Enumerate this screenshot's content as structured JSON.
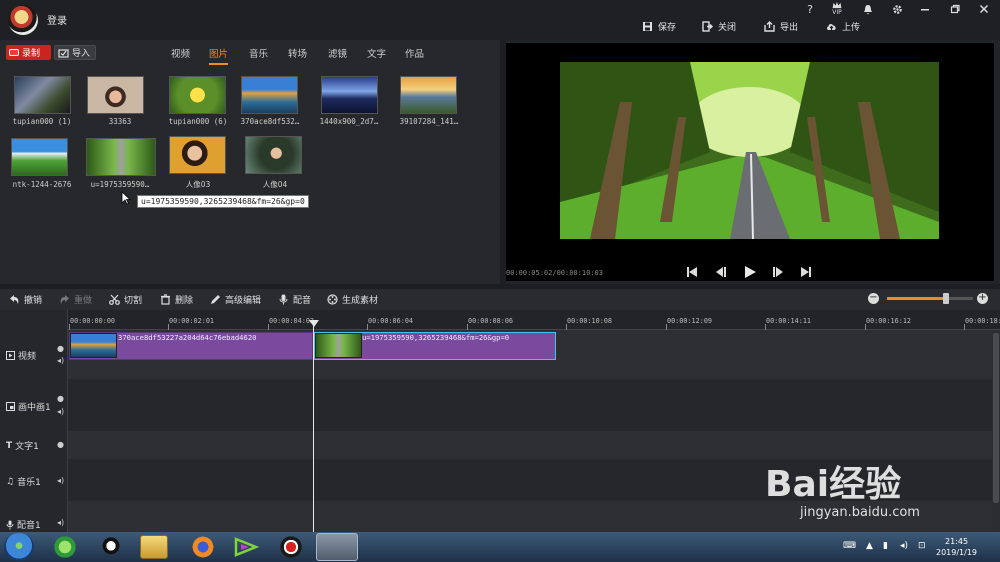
{
  "app": {
    "login_label": "登录"
  },
  "window_actions": [
    {
      "icon": "save-icon",
      "label": "保存"
    },
    {
      "icon": "close-file-icon",
      "label": "关闭"
    },
    {
      "icon": "export-icon",
      "label": "导出"
    },
    {
      "icon": "upload-icon",
      "label": "上传"
    }
  ],
  "window_controls": {
    "help": "?",
    "vip": "VIP"
  },
  "library": {
    "record_label": "录制",
    "import_label": "导入",
    "tabs": [
      "视频",
      "图片",
      "音乐",
      "转场",
      "滤镜",
      "文字",
      "作品"
    ],
    "active_tab": "图片",
    "items": [
      {
        "caption": "tupian000 (1)"
      },
      {
        "caption": "33363"
      },
      {
        "caption": "tupian000 (6)"
      },
      {
        "caption": "370ace8df532…"
      },
      {
        "caption": "1440x900_2d7…"
      },
      {
        "caption": "39107284_141…"
      },
      {
        "caption": "ntk-1244-2676"
      },
      {
        "caption": "u=1975359590…"
      },
      {
        "caption": "人像03"
      },
      {
        "caption": "人像04"
      }
    ],
    "tooltip": "u=1975359590,3265239468&fm=26&gp=0"
  },
  "preview": {
    "time": "00:00:05:02/00:00:10:03"
  },
  "edit_toolbar": {
    "undo": "撤销",
    "redo": "重做",
    "cut": "切割",
    "delete": "删除",
    "advanced": "高级编辑",
    "dub": "配音",
    "generate": "生成素材"
  },
  "zoom": {
    "level": 0.7
  },
  "timeline": {
    "ticks": [
      "00:00:00:00",
      "00:00:02:01",
      "00:00:04:03",
      "00:00:06:04",
      "00:00:08:06",
      "00:00:10:08",
      "00:00:12:09",
      "00:00:14:11",
      "00:00:16:12",
      "00:00:18:"
    ],
    "tracks": [
      "视频",
      "画中画1",
      "文字1",
      "音乐1",
      "配音1"
    ],
    "clips": [
      {
        "name": "370ace8df53227a204d64c76ebad4620"
      },
      {
        "name": "u=1975359590,3265239468&fm=26&gp=0"
      }
    ]
  },
  "taskbar": {
    "time": "21:45",
    "date": "2019/1/19"
  },
  "watermark": {
    "brand": "Bai经验",
    "url": "jingyan.baidu.com"
  }
}
